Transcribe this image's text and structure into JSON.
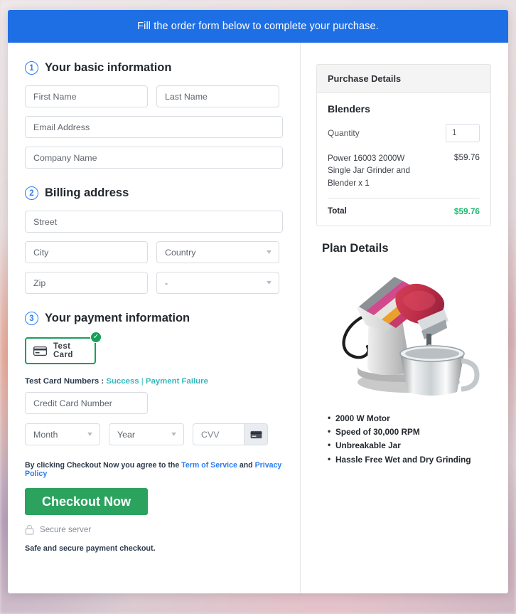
{
  "header": {
    "title": "Fill the order form below to complete your purchase."
  },
  "steps": {
    "basic": {
      "number": "1",
      "title": "Your basic information",
      "fields": {
        "first_name": "First Name",
        "last_name": "Last Name",
        "email": "Email Address",
        "company": "Company Name"
      }
    },
    "billing": {
      "number": "2",
      "title": "Billing address",
      "fields": {
        "street": "Street",
        "city": "City",
        "country": "Country",
        "zip": "Zip",
        "state": "-"
      }
    },
    "payment": {
      "number": "3",
      "title": "Your payment information",
      "test_card_button": "Test Card",
      "test_numbers_label": "Test Card Numbers :",
      "test_numbers_success": "Success",
      "test_numbers_separator": "|",
      "test_numbers_failure": "Payment Failure",
      "card_number": "Credit Card Number",
      "month": "Month",
      "year": "Year",
      "cvv": "CVV"
    }
  },
  "footer": {
    "agree_prefix": "By clicking Checkout Now you agree to the ",
    "terms_link": "Term of Service",
    "agree_middle": " and ",
    "privacy_link": "Privacy Policy",
    "checkout_button": "Checkout Now",
    "secure_server": "Secure server",
    "safe_note": "Safe and secure payment checkout."
  },
  "purchase_details": {
    "heading": "Purchase Details",
    "product_group": "Blenders",
    "quantity_label": "Quantity",
    "quantity_value": "1",
    "line_item_desc": "Power 16003 2000W Single Jar Grinder and Blender x 1",
    "line_item_price": "$59.76",
    "total_label": "Total",
    "total_value": "$59.76"
  },
  "plan_details": {
    "heading": "Plan Details",
    "features": [
      "2000 W Motor",
      "Speed of 30,000 RPM",
      "Unbreakable Jar",
      "Hassle Free Wet and Dry Grinding"
    ]
  },
  "colors": {
    "header_blue": "#1f6fe4",
    "accent_blue": "#2b7cf0",
    "success_green": "#2ba35e",
    "total_green": "#1bb76e",
    "card_border_green": "#16a05b",
    "link_teal": "#34b8bd"
  }
}
